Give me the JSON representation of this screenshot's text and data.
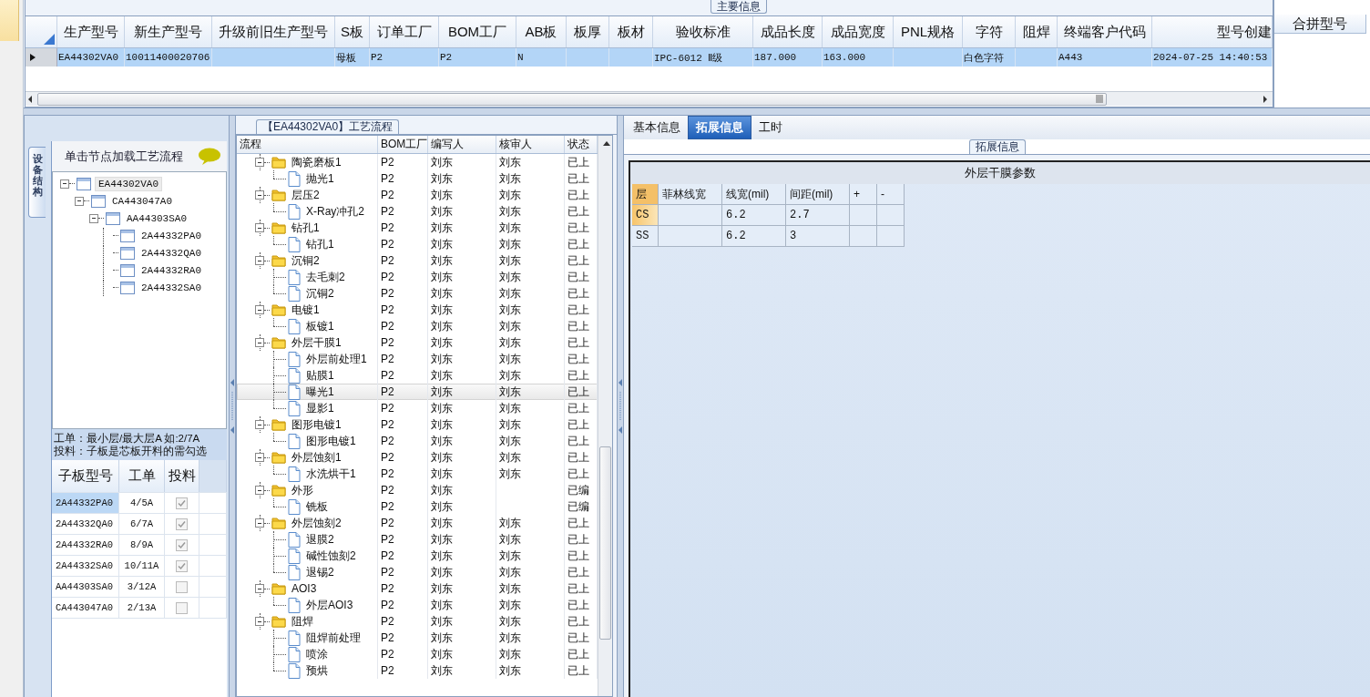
{
  "main_info": {
    "title": "主要信息",
    "columns": [
      "生产型号",
      "新生产型号",
      "升级前旧生产型号",
      "S板",
      "订单工厂",
      "BOM工厂",
      "AB板",
      "板厚",
      "板材",
      "验收标准",
      "成品长度",
      "成品宽度",
      "PNL规格",
      "字符",
      "阻焊",
      "终端客户代码",
      "型号创建"
    ],
    "rows": [
      {
        "selected": true,
        "cells": [
          "EA44302VA0",
          "10011400020706",
          null,
          "母板",
          "P2",
          "P2",
          "N",
          null,
          null,
          "IPC-6012 Ⅱ级",
          "187.000",
          "163.000",
          null,
          "白色字符",
          null,
          "A443",
          "2024-07-25 14:40:53"
        ]
      }
    ],
    "merge_panel": {
      "header": "合拼型号"
    }
  },
  "structure_panel": {
    "tab": "设备结构",
    "header": "单击节点加载工艺流程",
    "tree": [
      {
        "label": "EA44302VA0",
        "selected": true,
        "expanded": true,
        "children": [
          {
            "label": "CA443047A0",
            "selected": false,
            "expanded": true,
            "children": [
              {
                "label": "AA44303SA0",
                "selected": false,
                "expanded": true,
                "children": [
                  {
                    "label": "2A44332PA0",
                    "selected": false
                  },
                  {
                    "label": "2A44332QA0",
                    "selected": false
                  },
                  {
                    "label": "2A44332RA0",
                    "selected": false
                  },
                  {
                    "label": "2A44332SA0",
                    "selected": false
                  }
                ]
              }
            ]
          }
        ]
      }
    ],
    "notes": [
      "工单：最小层/最大层A 如:2/7A",
      "投料：子板是芯板开料的需勾选"
    ],
    "sub_boards": {
      "columns": [
        "子板型号",
        "工单",
        "投料"
      ],
      "rows": [
        {
          "model": "2A44332PA0",
          "order": "4/5A",
          "feed": true,
          "selected": true
        },
        {
          "model": "2A44332QA0",
          "order": "6/7A",
          "feed": true,
          "selected": false
        },
        {
          "model": "2A44332RA0",
          "order": "8/9A",
          "feed": true,
          "selected": false
        },
        {
          "model": "2A44332SA0",
          "order": "10/11A",
          "feed": true,
          "selected": false
        },
        {
          "model": "AA44303SA0",
          "order": "3/12A",
          "feed": false,
          "selected": false
        },
        {
          "model": "CA443047A0",
          "order": "2/13A",
          "feed": false,
          "selected": false
        }
      ]
    }
  },
  "process": {
    "title": "【EA44302VA0】工艺流程",
    "columns": [
      "流程",
      "BOM工厂",
      "编写人",
      "核审人",
      "状态"
    ],
    "steps": [
      {
        "name": "陶瓷磨板1",
        "factory": "P2",
        "writer": "刘东",
        "reviewer": "刘东",
        "status": "已上",
        "expanded": true,
        "selected": false,
        "children": [
          {
            "name": "抛光1",
            "factory": "P2",
            "writer": "刘东",
            "reviewer": "刘东",
            "status": "已上",
            "selected": false
          }
        ]
      },
      {
        "name": "层压2",
        "factory": "P2",
        "writer": "刘东",
        "reviewer": "刘东",
        "status": "已上",
        "expanded": true,
        "selected": false,
        "children": [
          {
            "name": "X-Ray冲孔2",
            "factory": "P2",
            "writer": "刘东",
            "reviewer": "刘东",
            "status": "已上",
            "selected": false
          }
        ]
      },
      {
        "name": "钻孔1",
        "factory": "P2",
        "writer": "刘东",
        "reviewer": "刘东",
        "status": "已上",
        "expanded": true,
        "selected": false,
        "children": [
          {
            "name": "钻孔1",
            "factory": "P2",
            "writer": "刘东",
            "reviewer": "刘东",
            "status": "已上",
            "selected": false
          }
        ]
      },
      {
        "name": "沉铜2",
        "factory": "P2",
        "writer": "刘东",
        "reviewer": "刘东",
        "status": "已上",
        "expanded": true,
        "selected": false,
        "children": [
          {
            "name": "去毛刺2",
            "factory": "P2",
            "writer": "刘东",
            "reviewer": "刘东",
            "status": "已上",
            "selected": false
          },
          {
            "name": "沉铜2",
            "factory": "P2",
            "writer": "刘东",
            "reviewer": "刘东",
            "status": "已上",
            "selected": false
          }
        ]
      },
      {
        "name": "电镀1",
        "factory": "P2",
        "writer": "刘东",
        "reviewer": "刘东",
        "status": "已上",
        "expanded": true,
        "selected": false,
        "children": [
          {
            "name": "板镀1",
            "factory": "P2",
            "writer": "刘东",
            "reviewer": "刘东",
            "status": "已上",
            "selected": false
          }
        ]
      },
      {
        "name": "外层干膜1",
        "factory": "P2",
        "writer": "刘东",
        "reviewer": "刘东",
        "status": "已上",
        "expanded": true,
        "selected": false,
        "children": [
          {
            "name": "外层前处理1",
            "factory": "P2",
            "writer": "刘东",
            "reviewer": "刘东",
            "status": "已上",
            "selected": false
          },
          {
            "name": "贴膜1",
            "factory": "P2",
            "writer": "刘东",
            "reviewer": "刘东",
            "status": "已上",
            "selected": false
          },
          {
            "name": "曝光1",
            "factory": "P2",
            "writer": "刘东",
            "reviewer": "刘东",
            "status": "已上",
            "selected": true
          },
          {
            "name": "显影1",
            "factory": "P2",
            "writer": "刘东",
            "reviewer": "刘东",
            "status": "已上",
            "selected": false
          }
        ]
      },
      {
        "name": "图形电镀1",
        "factory": "P2",
        "writer": "刘东",
        "reviewer": "刘东",
        "status": "已上",
        "expanded": true,
        "selected": false,
        "children": [
          {
            "name": "图形电镀1",
            "factory": "P2",
            "writer": "刘东",
            "reviewer": "刘东",
            "status": "已上",
            "selected": false
          }
        ]
      },
      {
        "name": "外层蚀刻1",
        "factory": "P2",
        "writer": "刘东",
        "reviewer": "刘东",
        "status": "已上",
        "expanded": true,
        "selected": false,
        "children": [
          {
            "name": "水洗烘干1",
            "factory": "P2",
            "writer": "刘东",
            "reviewer": "刘东",
            "status": "已上",
            "selected": false
          }
        ]
      },
      {
        "name": "外形",
        "factory": "P2",
        "writer": "刘东",
        "status": "已编",
        "expanded": true,
        "selected": false,
        "children": [
          {
            "name": "铣板",
            "factory": "P2",
            "writer": "刘东",
            "status": "已编",
            "selected": false
          }
        ]
      },
      {
        "name": "外层蚀刻2",
        "factory": "P2",
        "writer": "刘东",
        "reviewer": "刘东",
        "status": "已上",
        "expanded": true,
        "selected": false,
        "children": [
          {
            "name": "退膜2",
            "factory": "P2",
            "writer": "刘东",
            "reviewer": "刘东",
            "status": "已上",
            "selected": false
          },
          {
            "name": "碱性蚀刻2",
            "factory": "P2",
            "writer": "刘东",
            "reviewer": "刘东",
            "status": "已上",
            "selected": false
          },
          {
            "name": "退锡2",
            "factory": "P2",
            "writer": "刘东",
            "reviewer": "刘东",
            "status": "已上",
            "selected": false
          }
        ]
      },
      {
        "name": "AOI3",
        "factory": "P2",
        "writer": "刘东",
        "reviewer": "刘东",
        "status": "已上",
        "expanded": true,
        "selected": false,
        "children": [
          {
            "name": "外层AOI3",
            "factory": "P2",
            "writer": "刘东",
            "reviewer": "刘东",
            "status": "已上",
            "selected": false
          }
        ]
      },
      {
        "name": "阻焊",
        "factory": "P2",
        "writer": "刘东",
        "reviewer": "刘东",
        "status": "已上",
        "expanded": true,
        "selected": false,
        "children": [
          {
            "name": "阻焊前处理",
            "factory": "P2",
            "writer": "刘东",
            "reviewer": "刘东",
            "status": "已上",
            "selected": false
          },
          {
            "name": "喷涂",
            "factory": "P2",
            "writer": "刘东",
            "reviewer": "刘东",
            "status": "已上",
            "selected": false
          },
          {
            "name": "预烘",
            "factory": "P2",
            "writer": "刘东",
            "reviewer": "刘东",
            "status": "已上",
            "selected": false
          }
        ]
      }
    ]
  },
  "detail": {
    "tabs": [
      {
        "label": "基本信息",
        "selected": false
      },
      {
        "label": "拓展信息",
        "selected": true
      },
      {
        "label": "工时",
        "selected": false
      }
    ],
    "group_title": "拓展信息",
    "table_title": "外层干膜参数",
    "columns": [
      "层",
      "菲林线宽",
      "线宽(mil)",
      "间距(mil)",
      "+",
      "-"
    ],
    "rows": [
      {
        "selected": true,
        "cells": [
          "CS",
          null,
          "6.2",
          "2.7",
          null,
          null
        ]
      },
      {
        "selected": false,
        "cells": [
          "SS",
          null,
          "6.2",
          "3",
          null,
          null
        ]
      }
    ]
  }
}
